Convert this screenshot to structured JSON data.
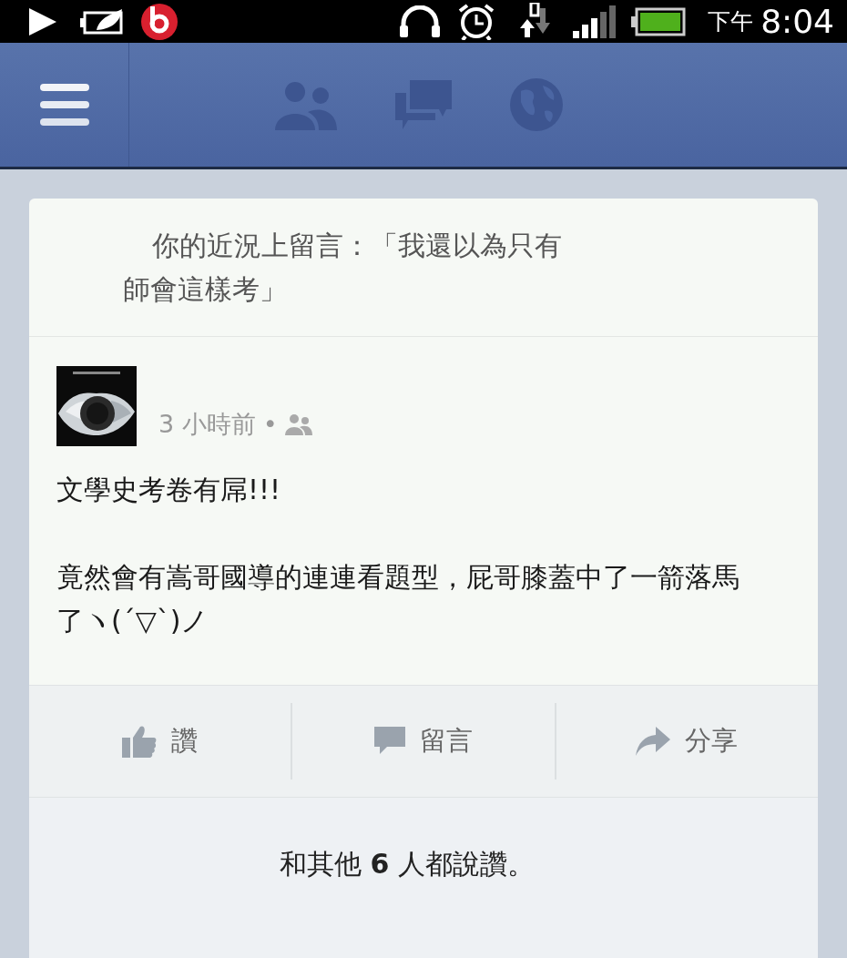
{
  "status_bar": {
    "time_period": "下午",
    "time": "8:04"
  },
  "notification": {
    "lines": [
      "你的近況上留言：「我還以為只有",
      "師會這樣考」"
    ]
  },
  "post": {
    "time": "3 小時前",
    "separator": "•",
    "paragraphs": [
      "文學史考卷有屌!!!",
      "竟然會有嵩哥國導的連連看題型，屁哥膝蓋中了一箭落馬了ヽ(ˊ▽ˋ)ノ"
    ]
  },
  "actions": [
    {
      "kind": "like",
      "label": "讚"
    },
    {
      "kind": "comment",
      "label": "留言"
    },
    {
      "kind": "share",
      "label": "分享"
    }
  ],
  "likes": {
    "text": "和其他 **6** 人都說讚。"
  }
}
